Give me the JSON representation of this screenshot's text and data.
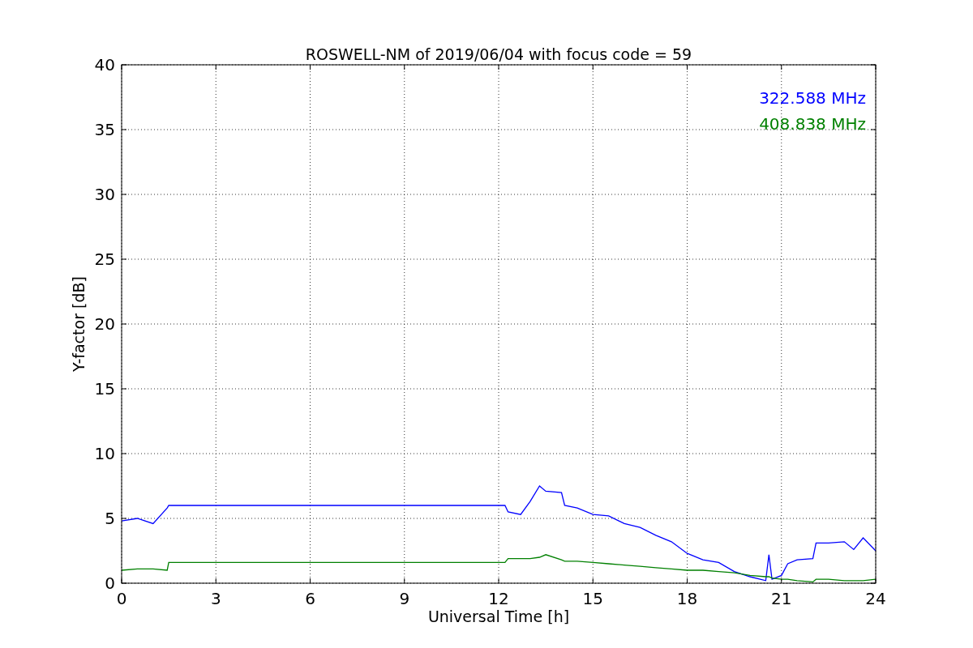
{
  "chart_data": {
    "type": "line",
    "title": "ROSWELL-NM of 2019/06/04 with focus code = 59",
    "xlabel": "Universal Time [h]",
    "ylabel": "Y-factor [dB]",
    "x": [
      0,
      0.5,
      1,
      1.45,
      1.5,
      12.2,
      12.3,
      12.7,
      13,
      13.3,
      13.5,
      14,
      14.1,
      14.5,
      15,
      15.5,
      16,
      16.5,
      17,
      17.5,
      18,
      18.5,
      19,
      19.5,
      20,
      20.5,
      20.6,
      20.7,
      21,
      21.2,
      21.5,
      22,
      22.1,
      22.5,
      23,
      23.3,
      23.6,
      24
    ],
    "series": [
      {
        "name": "322.588 MHz",
        "color": "#0000ff",
        "values": [
          4.8,
          5.0,
          4.6,
          5.8,
          6.0,
          6.0,
          5.5,
          5.3,
          6.3,
          7.5,
          7.1,
          7.0,
          6.0,
          5.8,
          5.3,
          5.2,
          4.6,
          4.3,
          3.7,
          3.2,
          2.3,
          1.8,
          1.6,
          0.9,
          0.5,
          0.2,
          2.2,
          0.3,
          0.6,
          1.5,
          1.8,
          1.9,
          3.1,
          3.1,
          3.2,
          2.6,
          3.5,
          2.5
        ]
      },
      {
        "name": "408.838 MHz",
        "color": "#008000",
        "values": [
          1.0,
          1.1,
          1.1,
          1.0,
          1.6,
          1.6,
          1.9,
          1.9,
          1.9,
          2.0,
          2.2,
          1.8,
          1.7,
          1.7,
          1.6,
          1.5,
          1.4,
          1.3,
          1.2,
          1.1,
          1.0,
          1.0,
          0.9,
          0.8,
          0.6,
          0.5,
          0.5,
          0.4,
          0.3,
          0.3,
          0.2,
          0.1,
          0.3,
          0.3,
          0.2,
          0.2,
          0.2,
          0.3
        ]
      }
    ],
    "grid": true,
    "xlim": [
      0,
      24
    ],
    "ylim": [
      0,
      40
    ],
    "xticks": [
      0,
      3,
      6,
      9,
      12,
      15,
      18,
      21,
      24
    ],
    "yticks": [
      0,
      5,
      10,
      15,
      20,
      25,
      30,
      35,
      40
    ]
  }
}
